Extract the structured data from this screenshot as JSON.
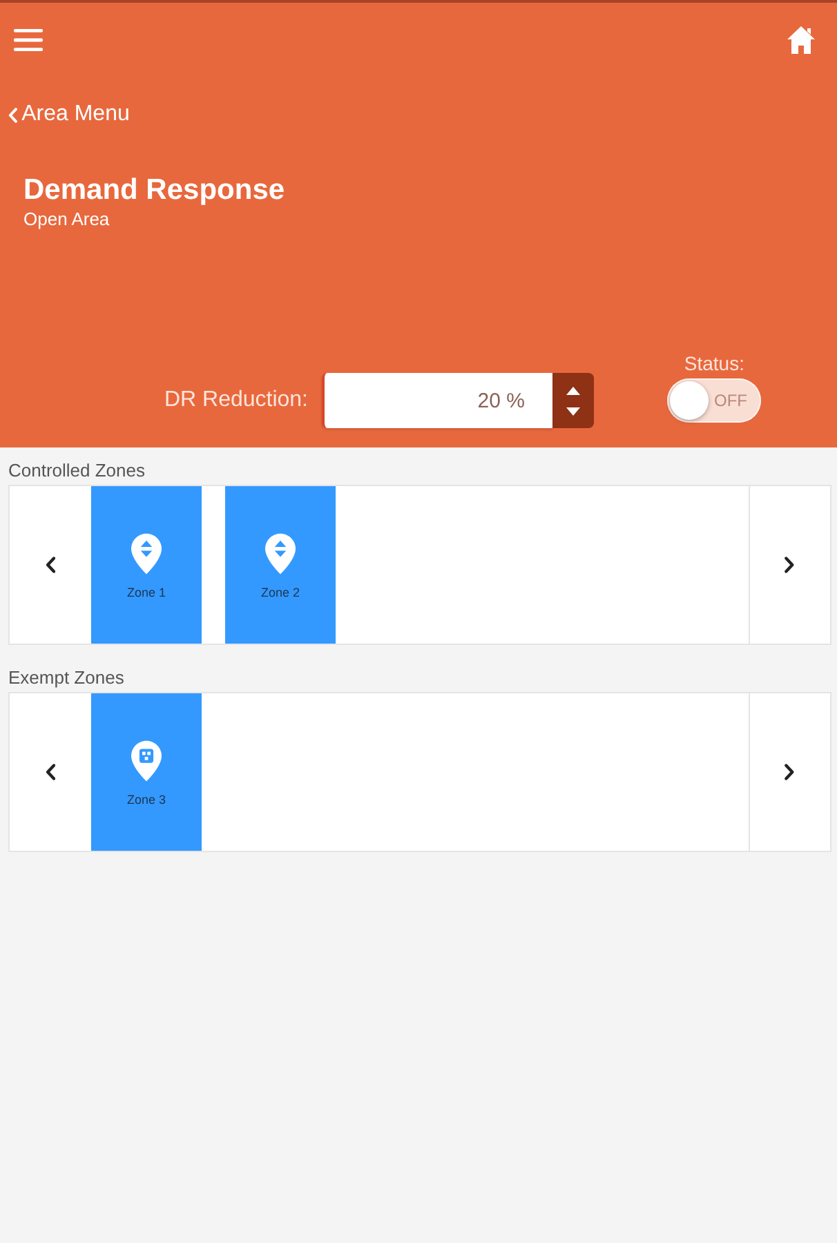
{
  "back_link": {
    "label": "Area Menu"
  },
  "title": "Demand Response",
  "subtitle": "Open Area",
  "dr_reduction": {
    "label": "DR Reduction:",
    "value": "20 %"
  },
  "status": {
    "label": "Status:",
    "on": false,
    "toggle_text": "OFF"
  },
  "zone_sections": [
    {
      "kind": "controlled",
      "label": "Controlled Zones",
      "zones": [
        {
          "name": "Zone 1"
        },
        {
          "name": "Zone 2"
        }
      ]
    },
    {
      "kind": "exempt",
      "label": "Exempt Zones",
      "zones": [
        {
          "name": "Zone 3"
        }
      ]
    }
  ]
}
